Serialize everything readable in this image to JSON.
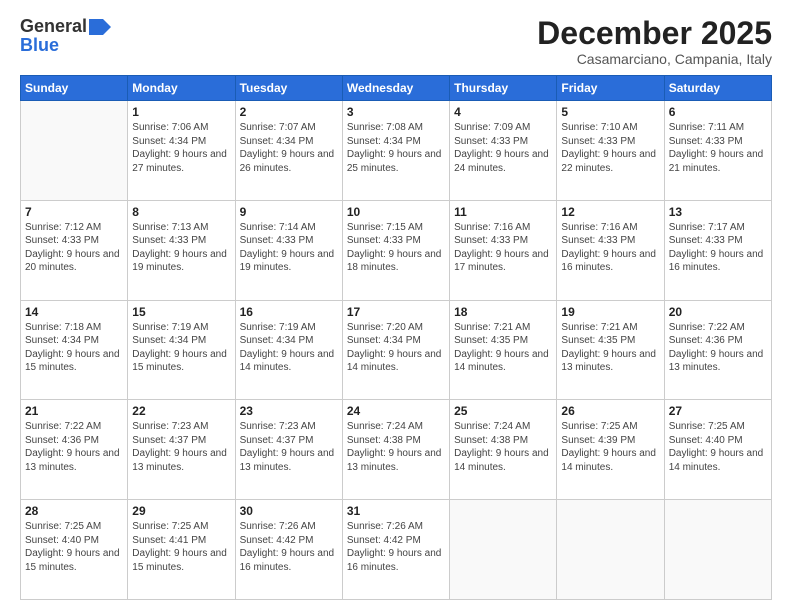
{
  "logo": {
    "general": "General",
    "blue": "Blue"
  },
  "header": {
    "title": "December 2025",
    "location": "Casamarciano, Campania, Italy"
  },
  "weekdays": [
    "Sunday",
    "Monday",
    "Tuesday",
    "Wednesday",
    "Thursday",
    "Friday",
    "Saturday"
  ],
  "weeks": [
    [
      {
        "day": "",
        "sunrise": "",
        "sunset": "",
        "daylight": ""
      },
      {
        "day": "1",
        "sunrise": "Sunrise: 7:06 AM",
        "sunset": "Sunset: 4:34 PM",
        "daylight": "Daylight: 9 hours and 27 minutes."
      },
      {
        "day": "2",
        "sunrise": "Sunrise: 7:07 AM",
        "sunset": "Sunset: 4:34 PM",
        "daylight": "Daylight: 9 hours and 26 minutes."
      },
      {
        "day": "3",
        "sunrise": "Sunrise: 7:08 AM",
        "sunset": "Sunset: 4:34 PM",
        "daylight": "Daylight: 9 hours and 25 minutes."
      },
      {
        "day": "4",
        "sunrise": "Sunrise: 7:09 AM",
        "sunset": "Sunset: 4:33 PM",
        "daylight": "Daylight: 9 hours and 24 minutes."
      },
      {
        "day": "5",
        "sunrise": "Sunrise: 7:10 AM",
        "sunset": "Sunset: 4:33 PM",
        "daylight": "Daylight: 9 hours and 22 minutes."
      },
      {
        "day": "6",
        "sunrise": "Sunrise: 7:11 AM",
        "sunset": "Sunset: 4:33 PM",
        "daylight": "Daylight: 9 hours and 21 minutes."
      }
    ],
    [
      {
        "day": "7",
        "sunrise": "Sunrise: 7:12 AM",
        "sunset": "Sunset: 4:33 PM",
        "daylight": "Daylight: 9 hours and 20 minutes."
      },
      {
        "day": "8",
        "sunrise": "Sunrise: 7:13 AM",
        "sunset": "Sunset: 4:33 PM",
        "daylight": "Daylight: 9 hours and 19 minutes."
      },
      {
        "day": "9",
        "sunrise": "Sunrise: 7:14 AM",
        "sunset": "Sunset: 4:33 PM",
        "daylight": "Daylight: 9 hours and 19 minutes."
      },
      {
        "day": "10",
        "sunrise": "Sunrise: 7:15 AM",
        "sunset": "Sunset: 4:33 PM",
        "daylight": "Daylight: 9 hours and 18 minutes."
      },
      {
        "day": "11",
        "sunrise": "Sunrise: 7:16 AM",
        "sunset": "Sunset: 4:33 PM",
        "daylight": "Daylight: 9 hours and 17 minutes."
      },
      {
        "day": "12",
        "sunrise": "Sunrise: 7:16 AM",
        "sunset": "Sunset: 4:33 PM",
        "daylight": "Daylight: 9 hours and 16 minutes."
      },
      {
        "day": "13",
        "sunrise": "Sunrise: 7:17 AM",
        "sunset": "Sunset: 4:33 PM",
        "daylight": "Daylight: 9 hours and 16 minutes."
      }
    ],
    [
      {
        "day": "14",
        "sunrise": "Sunrise: 7:18 AM",
        "sunset": "Sunset: 4:34 PM",
        "daylight": "Daylight: 9 hours and 15 minutes."
      },
      {
        "day": "15",
        "sunrise": "Sunrise: 7:19 AM",
        "sunset": "Sunset: 4:34 PM",
        "daylight": "Daylight: 9 hours and 15 minutes."
      },
      {
        "day": "16",
        "sunrise": "Sunrise: 7:19 AM",
        "sunset": "Sunset: 4:34 PM",
        "daylight": "Daylight: 9 hours and 14 minutes."
      },
      {
        "day": "17",
        "sunrise": "Sunrise: 7:20 AM",
        "sunset": "Sunset: 4:34 PM",
        "daylight": "Daylight: 9 hours and 14 minutes."
      },
      {
        "day": "18",
        "sunrise": "Sunrise: 7:21 AM",
        "sunset": "Sunset: 4:35 PM",
        "daylight": "Daylight: 9 hours and 14 minutes."
      },
      {
        "day": "19",
        "sunrise": "Sunrise: 7:21 AM",
        "sunset": "Sunset: 4:35 PM",
        "daylight": "Daylight: 9 hours and 13 minutes."
      },
      {
        "day": "20",
        "sunrise": "Sunrise: 7:22 AM",
        "sunset": "Sunset: 4:36 PM",
        "daylight": "Daylight: 9 hours and 13 minutes."
      }
    ],
    [
      {
        "day": "21",
        "sunrise": "Sunrise: 7:22 AM",
        "sunset": "Sunset: 4:36 PM",
        "daylight": "Daylight: 9 hours and 13 minutes."
      },
      {
        "day": "22",
        "sunrise": "Sunrise: 7:23 AM",
        "sunset": "Sunset: 4:37 PM",
        "daylight": "Daylight: 9 hours and 13 minutes."
      },
      {
        "day": "23",
        "sunrise": "Sunrise: 7:23 AM",
        "sunset": "Sunset: 4:37 PM",
        "daylight": "Daylight: 9 hours and 13 minutes."
      },
      {
        "day": "24",
        "sunrise": "Sunrise: 7:24 AM",
        "sunset": "Sunset: 4:38 PM",
        "daylight": "Daylight: 9 hours and 13 minutes."
      },
      {
        "day": "25",
        "sunrise": "Sunrise: 7:24 AM",
        "sunset": "Sunset: 4:38 PM",
        "daylight": "Daylight: 9 hours and 14 minutes."
      },
      {
        "day": "26",
        "sunrise": "Sunrise: 7:25 AM",
        "sunset": "Sunset: 4:39 PM",
        "daylight": "Daylight: 9 hours and 14 minutes."
      },
      {
        "day": "27",
        "sunrise": "Sunrise: 7:25 AM",
        "sunset": "Sunset: 4:40 PM",
        "daylight": "Daylight: 9 hours and 14 minutes."
      }
    ],
    [
      {
        "day": "28",
        "sunrise": "Sunrise: 7:25 AM",
        "sunset": "Sunset: 4:40 PM",
        "daylight": "Daylight: 9 hours and 15 minutes."
      },
      {
        "day": "29",
        "sunrise": "Sunrise: 7:25 AM",
        "sunset": "Sunset: 4:41 PM",
        "daylight": "Daylight: 9 hours and 15 minutes."
      },
      {
        "day": "30",
        "sunrise": "Sunrise: 7:26 AM",
        "sunset": "Sunset: 4:42 PM",
        "daylight": "Daylight: 9 hours and 16 minutes."
      },
      {
        "day": "31",
        "sunrise": "Sunrise: 7:26 AM",
        "sunset": "Sunset: 4:42 PM",
        "daylight": "Daylight: 9 hours and 16 minutes."
      },
      {
        "day": "",
        "sunrise": "",
        "sunset": "",
        "daylight": ""
      },
      {
        "day": "",
        "sunrise": "",
        "sunset": "",
        "daylight": ""
      },
      {
        "day": "",
        "sunrise": "",
        "sunset": "",
        "daylight": ""
      }
    ]
  ]
}
